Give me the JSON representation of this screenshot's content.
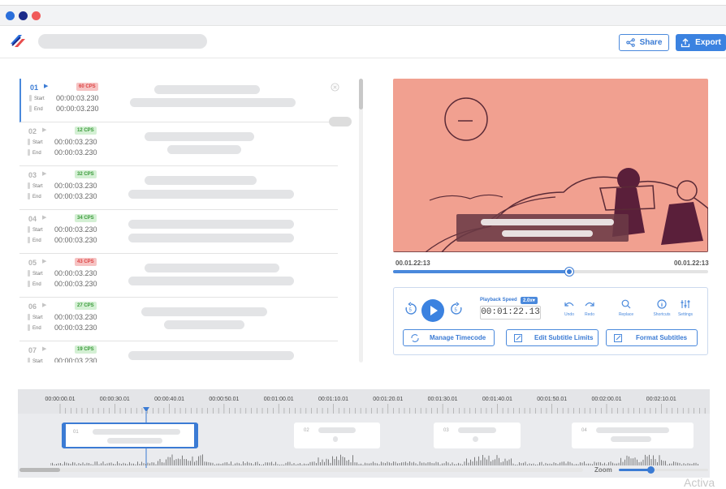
{
  "window": {
    "dots": [
      "#2a6fdb",
      "#1b2a8a",
      "#f05a5a"
    ]
  },
  "header": {
    "share_label": "Share",
    "export_label": "Export"
  },
  "subtitles": [
    {
      "num": "01",
      "cps": "60 CPS",
      "cps_status": "red",
      "start_label": "Start",
      "start": "00:00:03.230",
      "end_label": "End",
      "end": "00:00:03.230",
      "active": true
    },
    {
      "num": "02",
      "cps": "12 CPS",
      "cps_status": "green",
      "start_label": "Start",
      "start": "00:00:03.230",
      "end_label": "End",
      "end": "00:00:03.230",
      "active": false
    },
    {
      "num": "03",
      "cps": "32 CPS",
      "cps_status": "green",
      "start_label": "Start",
      "start": "00:00:03.230",
      "end_label": "End",
      "end": "00:00:03.230",
      "active": false
    },
    {
      "num": "04",
      "cps": "34 CPS",
      "cps_status": "green",
      "start_label": "Start",
      "start": "00:00:03.230",
      "end_label": "End",
      "end": "00:00:03.230",
      "active": false
    },
    {
      "num": "05",
      "cps": "43 CPS",
      "cps_status": "red",
      "start_label": "Start",
      "start": "00:00:03.230",
      "end_label": "End",
      "end": "00:00:03.230",
      "active": false
    },
    {
      "num": "06",
      "cps": "27 CPS",
      "cps_status": "green",
      "start_label": "Start",
      "start": "00:00:03.230",
      "end_label": "End",
      "end": "00:00:03.230",
      "active": false
    },
    {
      "num": "07",
      "cps": "19 CPS",
      "cps_status": "green",
      "start_label": "Start",
      "start": "00:00:03.230",
      "end_label": "End",
      "end": "00:00:03.230",
      "active": false
    }
  ],
  "player": {
    "time_left": "00.01.22:13",
    "time_right": "00.01.22:13",
    "progress": 0.56,
    "playback_speed_label": "Playback Speed",
    "playback_speed_value": "2.0x",
    "current_time": "00:01:22.13",
    "undo_label": "Undo",
    "redo_label": "Redo",
    "replace_label": "Replace",
    "shortcuts_label": "Shortcuts",
    "settings_label": "Settings",
    "manage_timecode": "Manage Timecode",
    "edit_limits": "Edit Subtitle Limits",
    "format_subtitles": "Format Subtitles"
  },
  "timeline": {
    "ticks": [
      "00:00:00.01",
      "00:00:30.01",
      "00:00:40.01",
      "00:00:50.01",
      "00:01:00.01",
      "00:01:10.01",
      "00:01:20.01",
      "00:01:30.01",
      "00:01:40.01",
      "00:01:50.01",
      "00:02:00.01",
      "00:02:10.01"
    ],
    "clips": [
      "01",
      "02",
      "03",
      "04"
    ],
    "zoom_label": "Zoom",
    "zoom_level": 0.35
  },
  "watermark": "Activa",
  "colors": {
    "accent": "#3b82e0",
    "video_bg": "#f1a090",
    "cps_red": "#d44",
    "cps_green": "#3a9a3a"
  }
}
